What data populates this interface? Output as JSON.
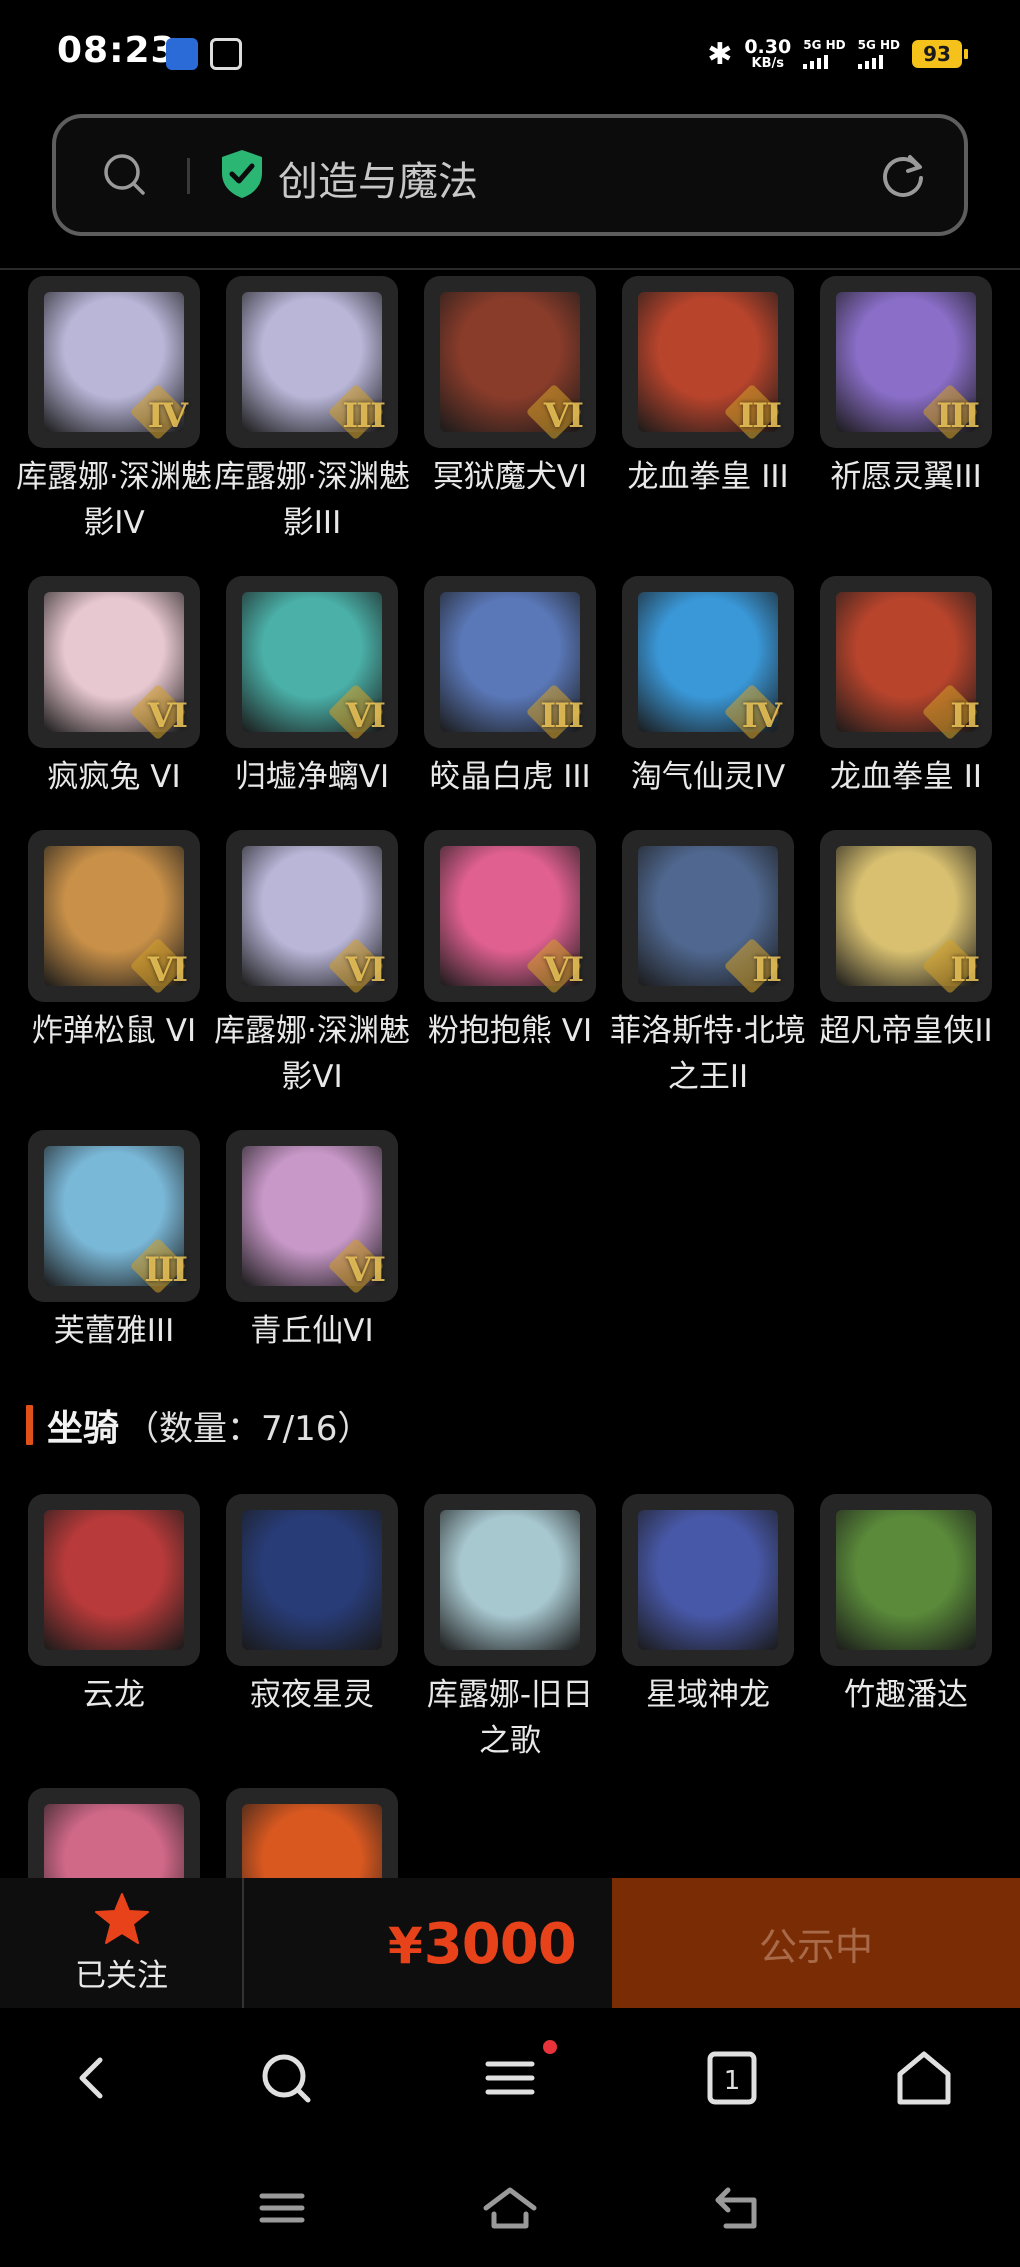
{
  "status_bar": {
    "time": "08:23",
    "net_speed_value": "0.30",
    "net_speed_unit": "KB/s",
    "sim1_label": "5G HD",
    "sim2_label": "5G HD",
    "battery": "93",
    "icons": [
      "app-notification-icon",
      "app-notification-icon-2",
      "bluetooth-icon",
      "signal-icon",
      "battery-icon"
    ]
  },
  "search": {
    "text": "创造与魔法",
    "icons": [
      "search-icon",
      "verified-shield-icon",
      "refresh-icon"
    ]
  },
  "skins": [
    {
      "name": "库露娜·深渊魅影IV",
      "tier": "IV",
      "color": "#b9b6d8"
    },
    {
      "name": "库露娜·深渊魅影III",
      "tier": "III",
      "color": "#b9b6d8"
    },
    {
      "name": "冥狱魔犬VI",
      "tier": "VI",
      "color": "#8a3c2a"
    },
    {
      "name": "龙血拳皇 III",
      "tier": "III",
      "color": "#b8442c"
    },
    {
      "name": "祈愿灵翼III",
      "tier": "III",
      "color": "#8a6ec8"
    },
    {
      "name": "疯疯兔 VI",
      "tier": "VI",
      "color": "#e8c8d0"
    },
    {
      "name": "归墟净螭VI",
      "tier": "VI",
      "color": "#4ab0a8"
    },
    {
      "name": "皎晶白虎 III",
      "tier": "III",
      "color": "#5a78b8"
    },
    {
      "name": "淘气仙灵IV",
      "tier": "IV",
      "color": "#3a98d8"
    },
    {
      "name": "龙血拳皇 II",
      "tier": "II",
      "color": "#b8442c"
    },
    {
      "name": "炸弹松鼠 VI",
      "tier": "VI",
      "color": "#c89048"
    },
    {
      "name": "库露娜·深渊魅影VI",
      "tier": "VI",
      "color": "#b9b6d8"
    },
    {
      "name": "粉抱抱熊 VI",
      "tier": "VI",
      "color": "#e06090"
    },
    {
      "name": "菲洛斯特·北境之王II",
      "tier": "II",
      "color": "#506890"
    },
    {
      "name": "超凡帝皇侠II",
      "tier": "II",
      "color": "#d8c070"
    },
    {
      "name": "芙蕾雅III",
      "tier": "III",
      "color": "#7ab8d8"
    },
    {
      "name": "青丘仙VI",
      "tier": "VI",
      "color": "#c898c8"
    }
  ],
  "mount_section": {
    "title": "坐骑",
    "count": "（数量：7/16）"
  },
  "mounts": [
    {
      "name": "云龙",
      "color": "#b83a3a"
    },
    {
      "name": "寂夜星灵",
      "color": "#283c78"
    },
    {
      "name": "库露娜-旧日之歌",
      "color": "#a8c8d0"
    },
    {
      "name": "星域神龙",
      "color": "#4858a8"
    },
    {
      "name": "竹趣潘达",
      "color": "#5a8a3a"
    }
  ],
  "partial_mounts": [
    {
      "color": "#d06888"
    },
    {
      "color": "#d85820"
    }
  ],
  "action_bar": {
    "follow_label": "已关注",
    "price_symbol": "¥",
    "price": "3000",
    "status_button": "公示中",
    "accent": "#e8421a"
  },
  "browser_nav": {
    "icons": [
      "back-icon",
      "search-icon",
      "menu-icon",
      "tabs-icon",
      "home-icon"
    ],
    "tab_count": "1"
  },
  "system_nav": {
    "icons": [
      "recents-icon",
      "home-icon",
      "back-icon"
    ]
  }
}
